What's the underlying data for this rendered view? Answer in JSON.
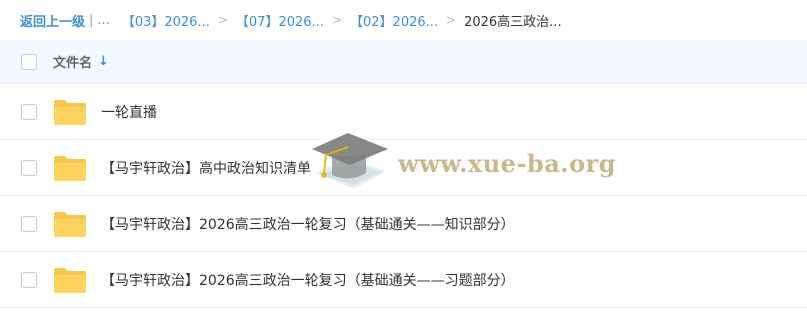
{
  "breadcrumb": {
    "back_label": "返回上一级",
    "pipe": "|",
    "ellipsis": "...",
    "items": [
      "【03】2026...",
      "【07】2026...",
      "【02】2026..."
    ],
    "current": "2026高三政治...",
    "separator": ">"
  },
  "header": {
    "column_label": "文件名",
    "sort_icon": "arrow-down-icon"
  },
  "files": [
    {
      "name": "一轮直播",
      "icon": "folder-icon"
    },
    {
      "name": "【马宇轩政治】高中政治知识清单",
      "icon": "folder-icon"
    },
    {
      "name": "【马宇轩政治】2026高三政治一轮复习（基础通关——知识部分）",
      "icon": "folder-icon"
    },
    {
      "name": "【马宇轩政治】2026高三政治一轮复习（基础通关——习题部分）",
      "icon": "folder-icon"
    }
  ],
  "watermark": {
    "text": "www.xue-ba.org",
    "icon": "graduation-cap-icon"
  },
  "colors": {
    "accent": "#3b8fd6",
    "folder": "#f9c84a",
    "header_bg": "#f2f8ff"
  }
}
